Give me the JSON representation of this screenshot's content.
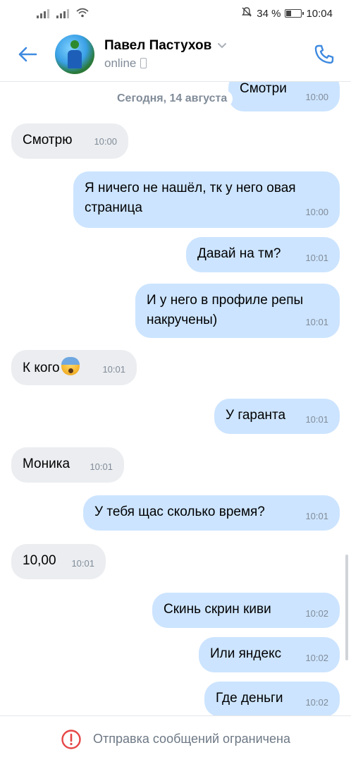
{
  "status_bar": {
    "battery_percent": "34 %",
    "time": "10:04",
    "icons": [
      "signal-icon",
      "signal-icon",
      "wifi-icon",
      "mute-icon",
      "battery-icon"
    ]
  },
  "header": {
    "name": "Павел Пастухов",
    "status": "online",
    "back_icon": "arrow-left-icon",
    "call_icon": "phone-icon"
  },
  "chat": {
    "date_label": "Сегодня, 14 августа",
    "messages": [
      {
        "dir": "out",
        "text": "Смотри",
        "time": "10:00"
      },
      {
        "dir": "in",
        "text": "Смотрю",
        "time": "10:00"
      },
      {
        "dir": "out",
        "text": "Я ничего не нашёл, тк у него овая страница",
        "time": "10:00"
      },
      {
        "dir": "out",
        "text": "Давай на тм?",
        "time": "10:01"
      },
      {
        "dir": "out",
        "text": "И у него в профиле репы накручены)",
        "time": "10:01"
      },
      {
        "dir": "in",
        "text": "К кого",
        "emoji": "fearful-face",
        "time": "10:01"
      },
      {
        "dir": "out",
        "text": "У гаранта",
        "time": "10:01"
      },
      {
        "dir": "in",
        "text": "Моника",
        "time": "10:01"
      },
      {
        "dir": "out",
        "text": "У тебя щас сколько время?",
        "time": "10:01"
      },
      {
        "dir": "in",
        "text": "10,00",
        "time": "10:01"
      },
      {
        "dir": "out",
        "text": "Скинь скрин киви",
        "time": "10:02"
      },
      {
        "dir": "out",
        "text": "Или яндекс",
        "time": "10:02"
      },
      {
        "dir": "out",
        "text": "Где деньги",
        "time": "10:02"
      }
    ]
  },
  "footer": {
    "text": "Отправка сообщений ограничена",
    "icon": "alert-circle-icon",
    "color": "#e64646"
  },
  "colors": {
    "accent": "#3f8ae0",
    "incoming_bubble": "#ebedf0",
    "outgoing_bubble": "#cce4ff"
  }
}
